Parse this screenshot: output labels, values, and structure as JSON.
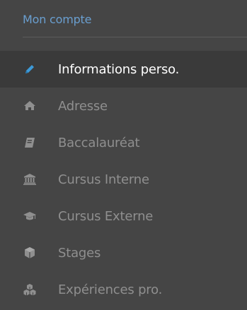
{
  "section": {
    "title": "Mon compte"
  },
  "nav": {
    "items": [
      {
        "label": "Informations perso.",
        "icon": "pencil-icon",
        "active": true
      },
      {
        "label": "Adresse",
        "icon": "home-icon",
        "active": false
      },
      {
        "label": "Baccalauréat",
        "icon": "book-icon",
        "active": false
      },
      {
        "label": "Cursus Interne",
        "icon": "institution-icon",
        "active": false
      },
      {
        "label": "Cursus Externe",
        "icon": "graduation-cap-icon",
        "active": false
      },
      {
        "label": "Stages",
        "icon": "cube-icon",
        "active": false
      },
      {
        "label": "Expériences pro.",
        "icon": "cubes-icon",
        "active": false
      }
    ]
  },
  "colors": {
    "background": "#454545",
    "active_background": "#3a3a3a",
    "title": "#6a9fd0",
    "active_text": "#ffffff",
    "inactive_text": "#8f8f8f",
    "active_icon": "#3d9ad8",
    "inactive_icon": "#8f8f8f"
  }
}
